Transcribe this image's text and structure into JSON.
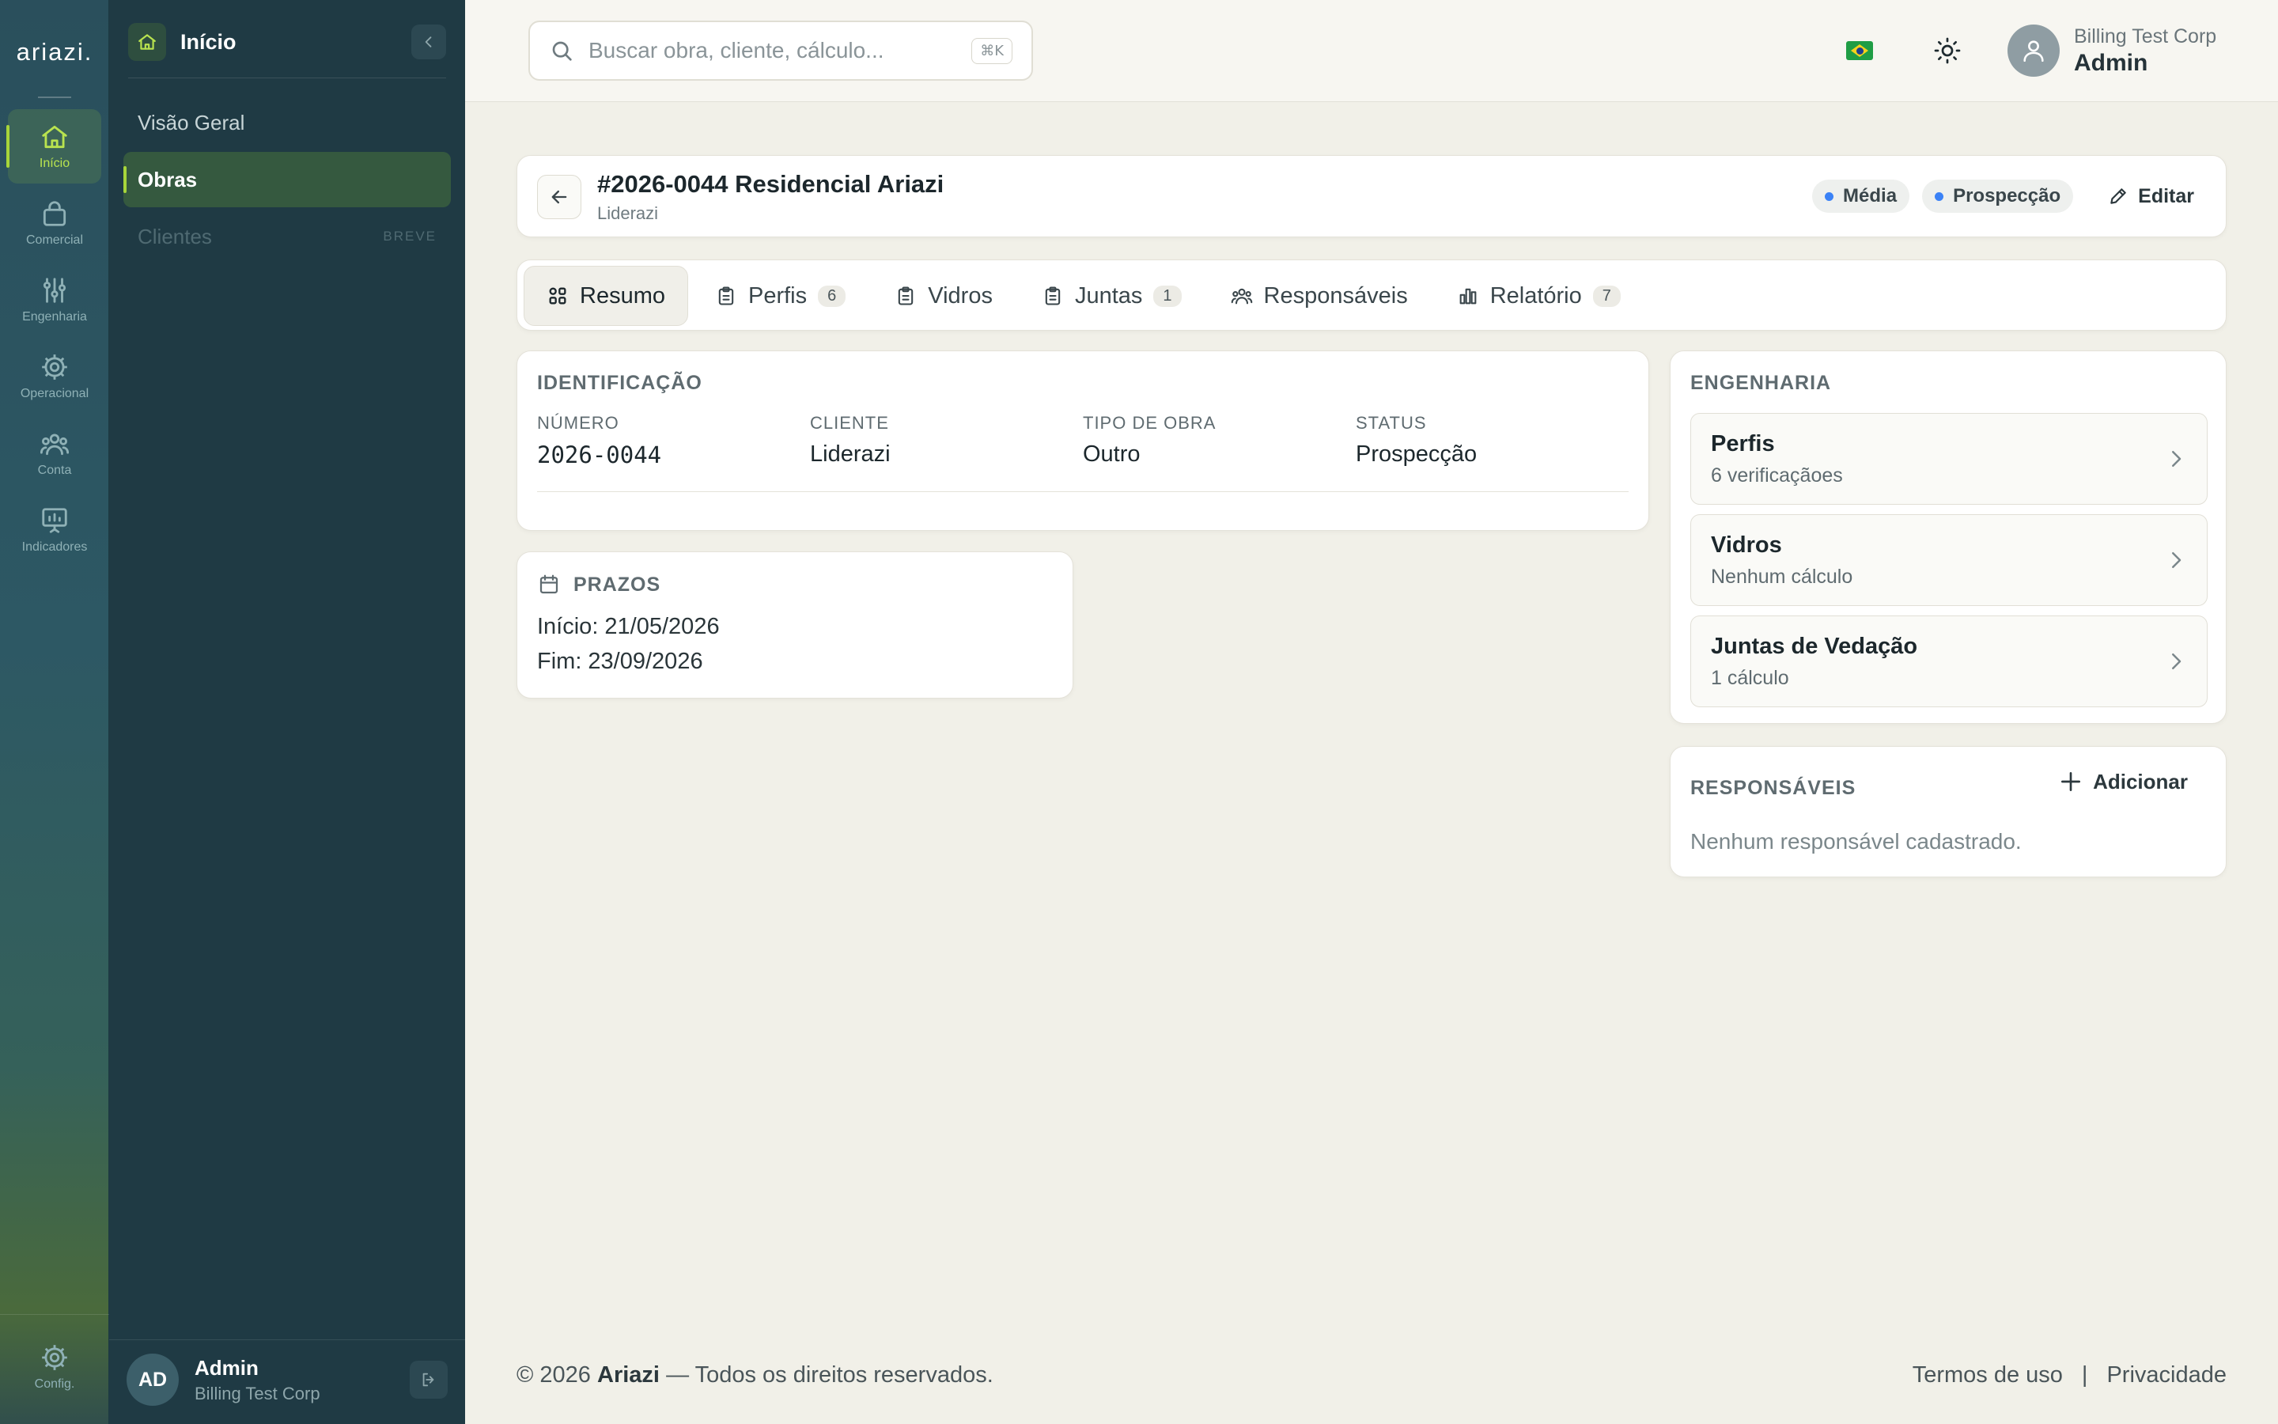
{
  "rail": {
    "logo": "ariazi.",
    "items": [
      {
        "label": "Início",
        "icon": "home-icon"
      },
      {
        "label": "Comercial",
        "icon": "bag-icon"
      },
      {
        "label": "Engenharia",
        "icon": "sliders-icon"
      },
      {
        "label": "Operacional",
        "icon": "gear-icon"
      },
      {
        "label": "Conta",
        "icon": "users-icon"
      },
      {
        "label": "Indicadores",
        "icon": "presentation-icon"
      }
    ],
    "settings_label": "Config."
  },
  "sidebar": {
    "title": "Início",
    "items": [
      {
        "label": "Visão Geral"
      },
      {
        "label": "Obras"
      },
      {
        "label": "Clientes",
        "badge": "BREVE"
      }
    ],
    "user": {
      "initials": "AD",
      "name": "Admin",
      "org": "Billing Test Corp"
    }
  },
  "topbar": {
    "search_placeholder": "Buscar obra, cliente, cálculo...",
    "shortcut": "⌘K",
    "user_org": "Billing Test Corp",
    "user_name": "Admin"
  },
  "header": {
    "title": "#2026-0044 Residencial Ariazi",
    "subtitle": "Liderazi",
    "priority": "Média",
    "stage": "Prospecção",
    "edit_label": "Editar",
    "accent_dot": "#3b82f6"
  },
  "tabs": [
    {
      "label": "Resumo",
      "icon": "grid-icon"
    },
    {
      "label": "Perfis",
      "count": "6",
      "icon": "clipboard-icon"
    },
    {
      "label": "Vidros",
      "icon": "clipboard-icon"
    },
    {
      "label": "Juntas",
      "count": "1",
      "icon": "clipboard-icon"
    },
    {
      "label": "Responsáveis",
      "icon": "users-icon"
    },
    {
      "label": "Relatório",
      "count": "7",
      "icon": "bar-chart-icon"
    }
  ],
  "identificacao": {
    "title": "Identificação",
    "fields": [
      {
        "label": "NÚMERO",
        "value": "2026-0044"
      },
      {
        "label": "CLIENTE",
        "value": "Liderazi"
      },
      {
        "label": "TIPO DE OBRA",
        "value": "Outro"
      },
      {
        "label": "STATUS",
        "value": "Prospecção"
      }
    ]
  },
  "prazos": {
    "title": "PRAZOS",
    "inicio": "Início: 21/05/2026",
    "fim": "Fim: 23/09/2026"
  },
  "engenharia": {
    "title": "Engenharia",
    "items": [
      {
        "title": "Perfis",
        "subtitle": "6 verificaçãoes"
      },
      {
        "title": "Vidros",
        "subtitle": "Nenhum cálculo"
      },
      {
        "title": "Juntas de Vedação",
        "subtitle": "1 cálculo"
      }
    ]
  },
  "responsaveis": {
    "title": "Responsáveis",
    "add_label": "Adicionar",
    "empty": "Nenhum responsável cadastrado."
  },
  "footer": {
    "copyright": "© 2026",
    "brand": "Ariazi",
    "rights": "— Todos os direitos reservados.",
    "terms": "Termos de uso",
    "separator": "|",
    "privacy": "Privacidade"
  }
}
